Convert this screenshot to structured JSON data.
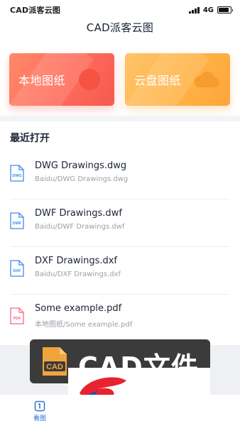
{
  "status_bar": {
    "app_name": "CAD派客云图",
    "network": "4G",
    "battery_level": 0.9
  },
  "header": {
    "title": "CAD派客云图"
  },
  "cards": {
    "local": {
      "label": "本地图纸",
      "color": "#ff6b5c",
      "icon": "circle-icon"
    },
    "cloud": {
      "label": "云盘图纸",
      "color": "#ffb347",
      "icon": "cloud-icon"
    }
  },
  "recent": {
    "title": "最近打开",
    "files": [
      {
        "name": "DWG Drawings.dwg",
        "path": "Baidu/DWG Drawings.dwg",
        "badge": "DWG",
        "color": "#3b8ee8"
      },
      {
        "name": "DWF Drawings.dwf",
        "path": "Baidu/DWF Drawings.dwf",
        "badge": "DWF",
        "color": "#3b8ee8"
      },
      {
        "name": "DXF Drawings.dxf",
        "path": "Baidu/DXF Drawings.dxf",
        "badge": "DXF",
        "color": "#3b8ee8"
      },
      {
        "name": "Some example.pdf",
        "path": "本地图纸/Some example.pdf",
        "badge": "PDF",
        "color": "#f06b86"
      }
    ]
  },
  "overlay": {
    "badge": "CAD",
    "text": "CAD文件",
    "badge_color": "#f0a53a"
  },
  "tab_bar": {
    "home_label": "看图",
    "accent": "#2d6fd6"
  }
}
